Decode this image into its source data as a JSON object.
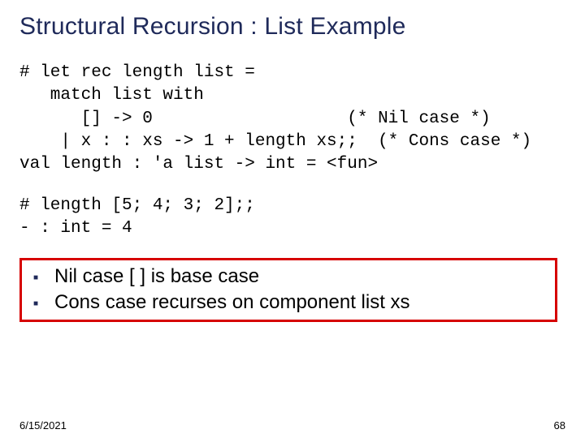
{
  "title": "Structural Recursion : List Example",
  "code_block_1": "# let rec length list =\n   match list with\n      [] -> 0                   (* Nil case *)\n    | x : : xs -> 1 + length xs;;  (* Cons case *)\nval length : 'a list -> int = <fun>",
  "code_block_2": "# length [5; 4; 3; 2];;\n- : int = 4",
  "bullets": [
    "Nil case [ ]  is base case",
    "Cons case recurses on component list xs"
  ],
  "footer": {
    "date": "6/15/2021",
    "page": "68"
  }
}
